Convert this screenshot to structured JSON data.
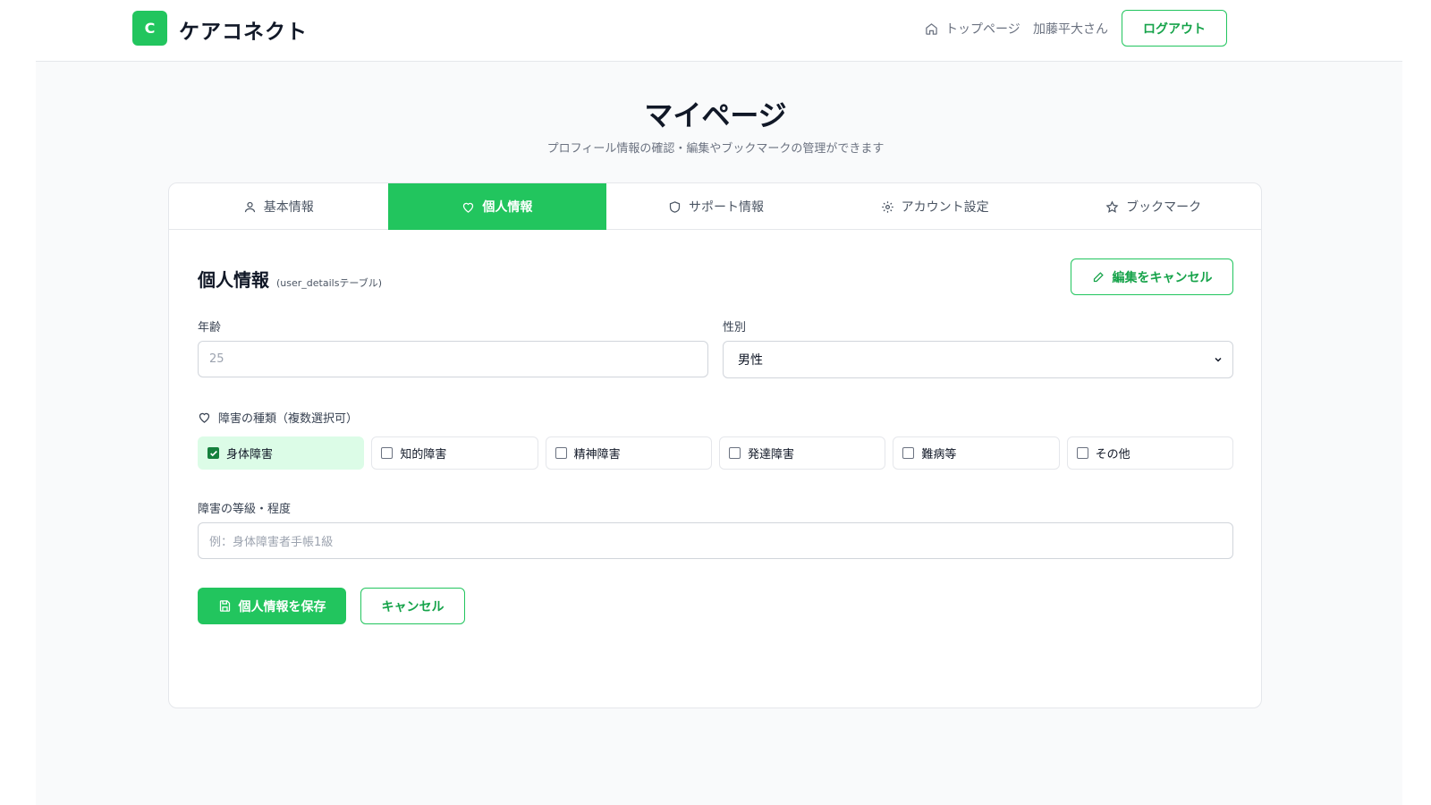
{
  "header": {
    "logo_letter": "C",
    "brand": "ケアコネクト",
    "home_link": "トップページ",
    "user_name": "加藤平大さん",
    "logout": "ログアウト"
  },
  "page": {
    "title": "マイページ",
    "subtitle": "プロフィール情報の確認・編集やブックマークの管理ができます"
  },
  "tabs": [
    {
      "label": "基本情報",
      "icon": "user-icon"
    },
    {
      "label": "個人情報",
      "icon": "heart-icon",
      "active": true
    },
    {
      "label": "サポート情報",
      "icon": "shield-icon"
    },
    {
      "label": "アカウント設定",
      "icon": "gear-icon"
    },
    {
      "label": "ブックマーク",
      "icon": "star-icon"
    }
  ],
  "section": {
    "title": "個人情報",
    "subtitle": "(user_detailsテーブル)",
    "edit_cancel": "編集をキャンセル"
  },
  "form": {
    "age_label": "年齢",
    "age_placeholder": "25",
    "gender_label": "性別",
    "gender_value": "男性",
    "disability_label": "障害の種類（複数選択可）",
    "disabilities": [
      {
        "label": "身体障害",
        "checked": true
      },
      {
        "label": "知的障害",
        "checked": false
      },
      {
        "label": "精神障害",
        "checked": false
      },
      {
        "label": "発達障害",
        "checked": false
      },
      {
        "label": "難病等",
        "checked": false
      },
      {
        "label": "その他",
        "checked": false
      }
    ],
    "grade_label": "障害の等級・程度",
    "grade_placeholder": "例：身体障害者手帳1級",
    "save": "個人情報を保存",
    "cancel": "キャンセル"
  },
  "colors": {
    "accent": "#22c55e",
    "accent_dark": "#16a34a",
    "checked_bg": "#dcfce7"
  }
}
